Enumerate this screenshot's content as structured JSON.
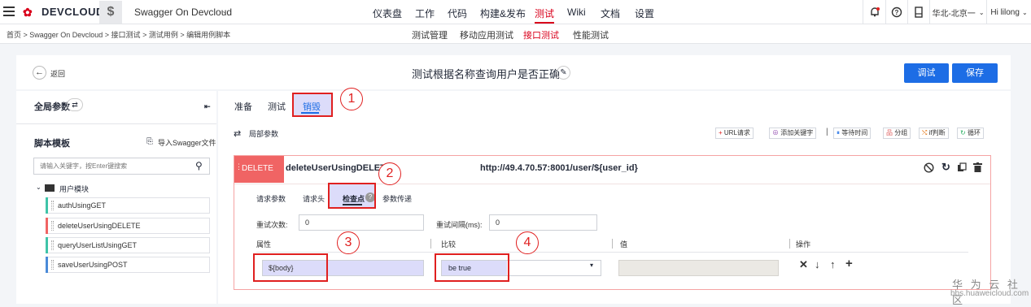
{
  "nav": {
    "brand": "DEVCLOUD",
    "project_icon": "$",
    "project": "Swagger On Devcloud",
    "items": [
      "仪表盘",
      "工作",
      "代码",
      "构建&发布",
      "测试",
      "Wiki",
      "文档",
      "设置"
    ],
    "active_index": 4,
    "region": "华北-北京一",
    "user": "Hi lilong"
  },
  "subnav": {
    "breadcrumb": "首页 > Swagger On Devcloud > 接口测试 > 测试用例 > 编辑用例脚本",
    "items": [
      "测试管理",
      "移动应用测试",
      "接口测试",
      "性能测试"
    ],
    "active_index": 2
  },
  "header": {
    "back": "返回",
    "title": "测试根据名称查询用户是否正确",
    "debug": "调试",
    "save": "保存"
  },
  "left": {
    "global_params": "全局参数",
    "script_template": "脚本模板",
    "import_swagger": "导入Swagger文件",
    "search_placeholder": "请输入关键字，按Enter键搜索",
    "folder": "用户模块",
    "items": [
      {
        "label": "authUsingGET",
        "color": "#3fc4a8"
      },
      {
        "label": "deleteUserUsingDELETE",
        "color": "#f06464"
      },
      {
        "label": "queryUserListUsingGET",
        "color": "#3fc4a8"
      },
      {
        "label": "saveUserUsingPOST",
        "color": "#4a8ad8"
      }
    ]
  },
  "main": {
    "tabs": [
      "准备",
      "测试",
      "销毁"
    ],
    "active_tab": 2,
    "local_params": "局部参数",
    "toolbar": [
      "URL请求",
      "添加关键字",
      "等待时间",
      "分组",
      "if判断",
      "循环"
    ],
    "method": "DELETE",
    "request_name": "deleteUserUsingDELETE",
    "url": "http://49.4.70.57:8001/user/${user_id}",
    "inner_tabs": [
      "请求参数",
      "请求头",
      "检查点",
      "参数传递"
    ],
    "active_inner_tab": 2,
    "retry_count_label": "重试次数:",
    "retry_count": "0",
    "retry_interval_label": "重试间隔(ms):",
    "retry_interval": "0",
    "columns": [
      "属性",
      "比较",
      "值",
      "操作"
    ],
    "attr_value": "${body}",
    "compare_value": "be true",
    "actions": [
      "✕",
      "↓",
      "↑",
      "+"
    ]
  },
  "callouts": [
    "1",
    "2",
    "3",
    "4"
  ],
  "watermark": {
    "line1": "华 为 云 社 区",
    "line2": "bbs.huaweicloud.com"
  },
  "colors": {
    "accent": "#1d6de5",
    "brand_red": "#d9001b",
    "delete": "#f06464",
    "highlight": "#dcdcfa",
    "annotation": "#e02020"
  }
}
